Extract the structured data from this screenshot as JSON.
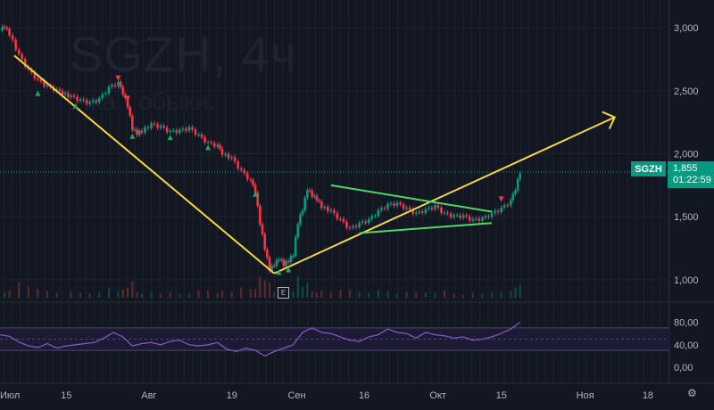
{
  "watermark": {
    "title": "SGZH, 4ч",
    "subtitle": "...ка - обыкн."
  },
  "price_tag": {
    "symbol": "SGZH",
    "price": "1,855",
    "countdown": "01:22:59"
  },
  "event_marker": "E",
  "colors": {
    "background": "#131722",
    "up": "#089981",
    "down": "#f23645",
    "trend": "#f5d742",
    "triangle": "#4cd964",
    "rsi": "#7e57c2"
  },
  "icons": {
    "settings": "gear-icon"
  },
  "chart_data": {
    "type": "candlestick",
    "price_axis": {
      "range": [
        850,
        3150
      ],
      "ticks": [
        3000,
        2500,
        2000,
        1500,
        1000
      ],
      "tick_labels": [
        "3,000",
        "2,500",
        "2,000",
        "1,500",
        "1,000"
      ]
    },
    "rsi_axis": {
      "range": [
        0,
        100
      ],
      "ticks": [
        80,
        40,
        0
      ],
      "tick_labels": [
        "80,00",
        "40,00",
        "0,00"
      ],
      "band": [
        30,
        70
      ],
      "mid": 50
    },
    "x_axis": {
      "range_days": [
        0,
        151
      ],
      "ticks": [
        0,
        14,
        31,
        49,
        62,
        77,
        92,
        106,
        123,
        137
      ],
      "tick_labels": [
        "Июл",
        "15",
        "Авг",
        "19",
        "Сен",
        "16",
        "Окт",
        "15",
        "Ноя",
        "18"
      ]
    },
    "price_path": [
      [
        0,
        2980
      ],
      [
        1,
        3010
      ],
      [
        2,
        2950
      ],
      [
        4,
        2780
      ],
      [
        6,
        2660
      ],
      [
        8,
        2580
      ],
      [
        10,
        2530
      ],
      [
        12,
        2500
      ],
      [
        15,
        2450
      ],
      [
        17,
        2420
      ],
      [
        19,
        2400
      ],
      [
        21,
        2430
      ],
      [
        23,
        2520
      ],
      [
        25,
        2560
      ],
      [
        26,
        2480
      ],
      [
        27,
        2380
      ],
      [
        28,
        2200
      ],
      [
        29,
        2160
      ],
      [
        30,
        2180
      ],
      [
        32,
        2230
      ],
      [
        34,
        2210
      ],
      [
        36,
        2170
      ],
      [
        38,
        2180
      ],
      [
        40,
        2200
      ],
      [
        42,
        2140
      ],
      [
        44,
        2080
      ],
      [
        46,
        2060
      ],
      [
        47,
        2000
      ],
      [
        49,
        1960
      ],
      [
        51,
        1860
      ],
      [
        53,
        1780
      ],
      [
        54,
        1700
      ],
      [
        55,
        1450
      ],
      [
        56,
        1250
      ],
      [
        57,
        1080
      ],
      [
        58,
        1120
      ],
      [
        59,
        1170
      ],
      [
        60,
        1120
      ],
      [
        61,
        1150
      ],
      [
        62,
        1200
      ],
      [
        63,
        1450
      ],
      [
        64,
        1560
      ],
      [
        65,
        1720
      ],
      [
        66,
        1670
      ],
      [
        67,
        1640
      ],
      [
        68,
        1580
      ],
      [
        70,
        1540
      ],
      [
        72,
        1470
      ],
      [
        74,
        1400
      ],
      [
        76,
        1440
      ],
      [
        78,
        1470
      ],
      [
        80,
        1540
      ],
      [
        82,
        1590
      ],
      [
        84,
        1600
      ],
      [
        86,
        1560
      ],
      [
        88,
        1520
      ],
      [
        90,
        1550
      ],
      [
        92,
        1580
      ],
      [
        94,
        1520
      ],
      [
        96,
        1500
      ],
      [
        98,
        1500
      ],
      [
        100,
        1470
      ],
      [
        102,
        1480
      ],
      [
        104,
        1520
      ],
      [
        106,
        1560
      ],
      [
        108,
        1620
      ],
      [
        109,
        1720
      ],
      [
        110,
        1855
      ]
    ],
    "rsi_path": [
      [
        0,
        58
      ],
      [
        2,
        55
      ],
      [
        4,
        45
      ],
      [
        6,
        38
      ],
      [
        8,
        35
      ],
      [
        10,
        42
      ],
      [
        12,
        34
      ],
      [
        14,
        38
      ],
      [
        16,
        40
      ],
      [
        18,
        42
      ],
      [
        20,
        44
      ],
      [
        22,
        52
      ],
      [
        24,
        62
      ],
      [
        26,
        54
      ],
      [
        28,
        38
      ],
      [
        30,
        42
      ],
      [
        32,
        44
      ],
      [
        34,
        40
      ],
      [
        36,
        46
      ],
      [
        38,
        48
      ],
      [
        40,
        40
      ],
      [
        42,
        38
      ],
      [
        44,
        40
      ],
      [
        46,
        44
      ],
      [
        48,
        32
      ],
      [
        50,
        28
      ],
      [
        52,
        34
      ],
      [
        54,
        30
      ],
      [
        56,
        20
      ],
      [
        58,
        28
      ],
      [
        60,
        34
      ],
      [
        62,
        40
      ],
      [
        64,
        62
      ],
      [
        66,
        70
      ],
      [
        68,
        62
      ],
      [
        70,
        60
      ],
      [
        72,
        54
      ],
      [
        74,
        48
      ],
      [
        76,
        46
      ],
      [
        78,
        54
      ],
      [
        80,
        58
      ],
      [
        82,
        68
      ],
      [
        84,
        62
      ],
      [
        86,
        60
      ],
      [
        88,
        52
      ],
      [
        90,
        62
      ],
      [
        92,
        58
      ],
      [
        94,
        56
      ],
      [
        96,
        52
      ],
      [
        98,
        54
      ],
      [
        100,
        48
      ],
      [
        102,
        50
      ],
      [
        104,
        54
      ],
      [
        106,
        60
      ],
      [
        108,
        68
      ],
      [
        110,
        80
      ]
    ],
    "drawings": {
      "downtrend": [
        [
          3,
          2780
        ],
        [
          58,
          1050
        ]
      ],
      "uptrend": [
        [
          58,
          1050
        ],
        [
          130,
          2290
        ]
      ],
      "triangle_upper": [
        [
          70,
          1750
        ],
        [
          104,
          1540
        ]
      ],
      "triangle_lower": [
        [
          76,
          1370
        ],
        [
          104,
          1450
        ]
      ]
    },
    "last_price": 1855
  }
}
